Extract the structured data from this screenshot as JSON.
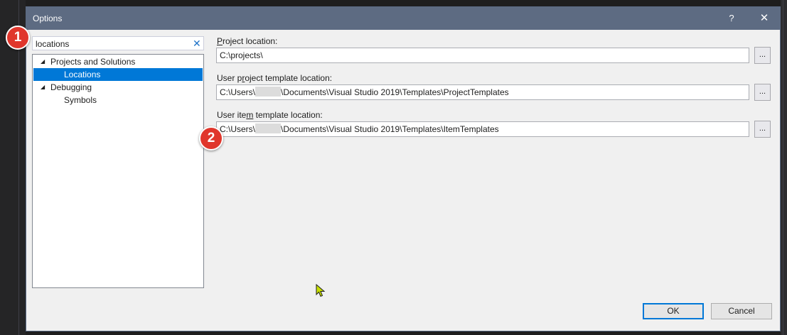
{
  "window": {
    "title": "Options",
    "help_label": "?",
    "close_label": "✕"
  },
  "search": {
    "value": "locations",
    "clear_label": "✕"
  },
  "tree": {
    "items": [
      {
        "label": "Projects and Solutions",
        "expander": "◢",
        "selected": false
      },
      {
        "label": "Locations",
        "expander": "",
        "selected": true
      },
      {
        "label": "Debugging",
        "expander": "◢",
        "selected": false
      },
      {
        "label": "Symbols",
        "expander": "",
        "selected": false
      }
    ]
  },
  "fields": [
    {
      "label_pre": "",
      "label_accel": "P",
      "label_post": "roject location:",
      "value_pre": "C:\\projects\\",
      "value_post": "",
      "browse_label": "..."
    },
    {
      "label_pre": "User p",
      "label_accel": "r",
      "label_post": "oject template location:",
      "value_pre": "C:\\Users\\",
      "value_post": "\\Documents\\Visual Studio 2019\\Templates\\ProjectTemplates",
      "browse_label": "..."
    },
    {
      "label_pre": "User ite",
      "label_accel": "m",
      "label_post": " template location:",
      "value_pre": "C:\\Users\\",
      "value_post": "\\Documents\\Visual Studio 2019\\Templates\\ItemTemplates",
      "browse_label": "..."
    }
  ],
  "buttons": {
    "ok_label": "OK",
    "cancel_label": "Cancel"
  },
  "badges": {
    "one": "1",
    "two": "2"
  },
  "colors": {
    "titlebar": "#5d6b82",
    "selection": "#0078d7",
    "badge": "#e0362c",
    "cursor": "#c8e000"
  },
  "icons": {
    "cursor": "mouse-cursor-icon",
    "clear": "close-icon",
    "close": "close-icon"
  }
}
